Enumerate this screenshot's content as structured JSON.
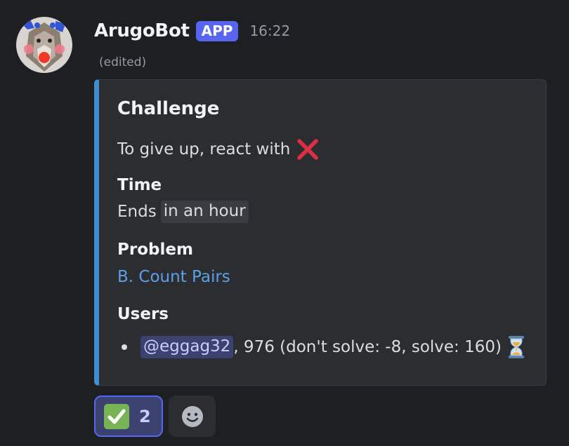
{
  "message": {
    "author": "ArugoBot",
    "badge": "APP",
    "time": "16:22",
    "edited_label": "(edited)",
    "avatar_icon": "wolf-avatar-icon"
  },
  "embed": {
    "accent_color": "#3e8ed0",
    "title": "Challenge",
    "description": "To give up, react with",
    "description_emoji": "cross-mark-icon",
    "fields": {
      "time": {
        "name": "Time",
        "prefix": "Ends",
        "chip": "in an hour"
      },
      "problem": {
        "name": "Problem",
        "link": "B. Count Pairs"
      },
      "users": {
        "name": "Users",
        "items": [
          {
            "mention": "@eggag32",
            "rest": ", 976 (don't solve: -8, solve: 160)",
            "status_icon": "hourglass-icon"
          }
        ]
      }
    }
  },
  "reactions": [
    {
      "emoji": "check-mark-button-icon",
      "count": "2",
      "active": true
    }
  ],
  "add_reaction_icon": "smiley-add-reaction-icon"
}
